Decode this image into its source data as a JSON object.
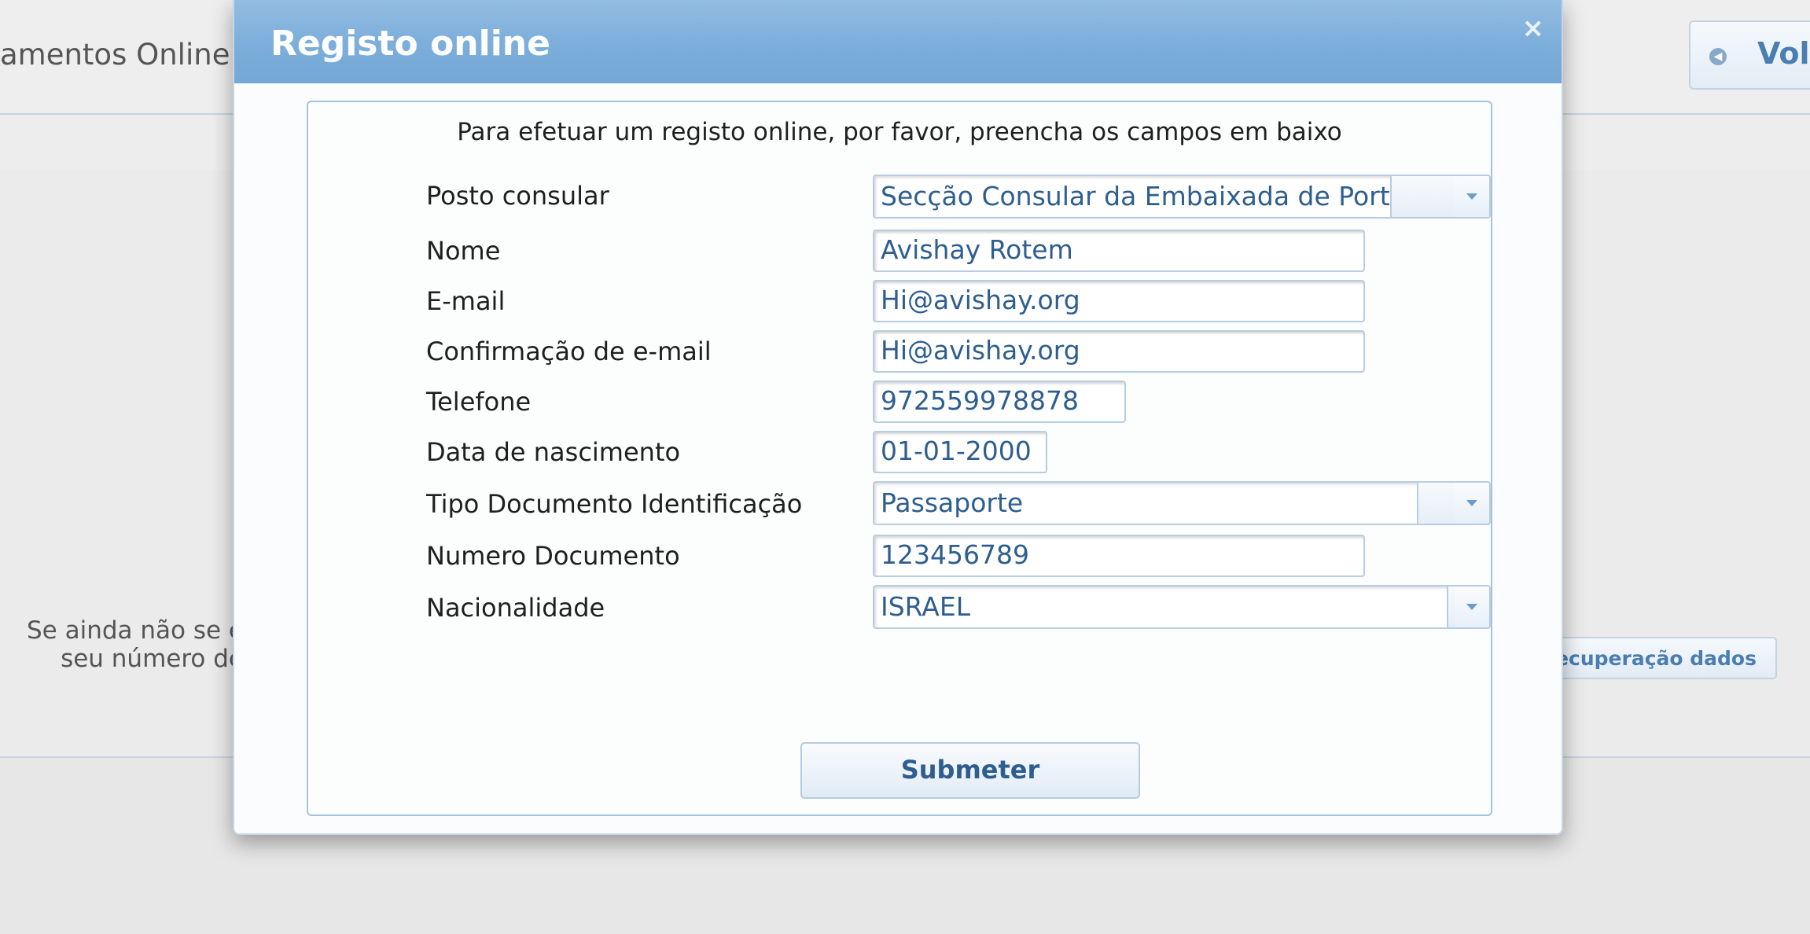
{
  "background": {
    "title": "amentos Online",
    "back_button": "Vol",
    "info_line1": "Se ainda não se e",
    "info_line2": "seu número de",
    "recover_button": "/Recuperação dados"
  },
  "modal": {
    "title": "Registo online",
    "close_icon": "×",
    "intro": "Para efetuar um registo online, por favor, preencha os campos em baixo",
    "fields": {
      "posto": {
        "label": "Posto consular",
        "value": "Secção Consular da Embaixada de Portugal"
      },
      "nome": {
        "label": "Nome",
        "value": "Avishay Rotem"
      },
      "email": {
        "label": "E-mail",
        "value": "Hi@avishay.org"
      },
      "email_confirm": {
        "label": "Confirmação de e-mail",
        "value": "Hi@avishay.org"
      },
      "telefone": {
        "label": "Telefone",
        "value": "972559978878"
      },
      "nascimento": {
        "label": "Data de nascimento",
        "value": "01-01-2000"
      },
      "tipo_doc": {
        "label": "Tipo Documento Identificação",
        "value": "Passaporte"
      },
      "numero_doc": {
        "label": "Numero Documento",
        "value": "123456789"
      },
      "nacionalidade": {
        "label": "Nacionalidade",
        "value": "ISRAEL"
      }
    },
    "submit": "Submeter"
  }
}
